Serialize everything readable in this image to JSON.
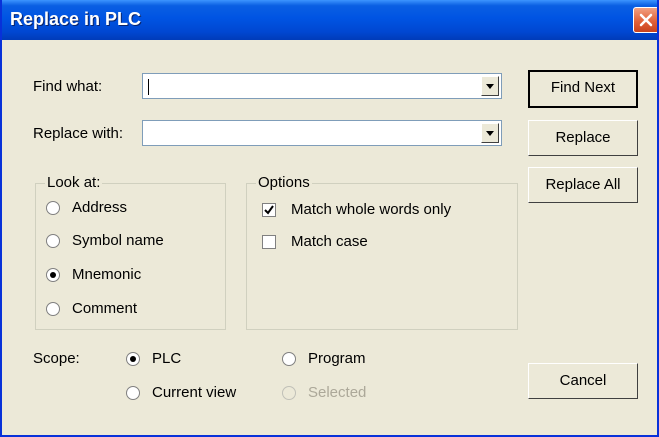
{
  "window": {
    "title": "Replace in PLC"
  },
  "find": {
    "label": "Find what:",
    "value": ""
  },
  "replace": {
    "label": "Replace with:",
    "value": ""
  },
  "buttons": {
    "find_next": "Find Next",
    "replace": "Replace",
    "replace_all": "Replace All",
    "cancel": "Cancel"
  },
  "look_at": {
    "title": "Look at:",
    "options": [
      "Address",
      "Symbol name",
      "Mnemonic",
      "Comment"
    ],
    "selected": "Mnemonic"
  },
  "options": {
    "title": "Options",
    "match_whole_words": {
      "label": "Match whole words only",
      "checked": true
    },
    "match_case": {
      "label": "Match case",
      "checked": false
    }
  },
  "scope": {
    "label": "Scope:",
    "options": [
      "PLC",
      "Program",
      "Current view",
      "Selected"
    ],
    "selected": "PLC",
    "disabled": [
      "Selected"
    ]
  },
  "colors": {
    "titlebar": "#0054e3",
    "dialog_bg": "#ece9d8",
    "close_button": "#e1623a"
  }
}
